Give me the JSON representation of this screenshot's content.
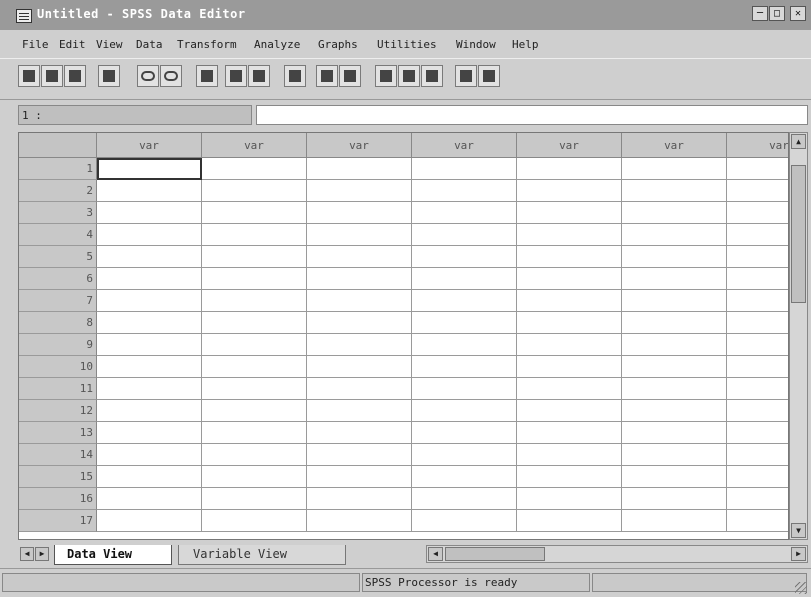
{
  "window": {
    "title": "Untitled - SPSS Data Editor"
  },
  "menu": [
    "File",
    "Edit",
    "View",
    "Data",
    "Transform",
    "Analyze",
    "Graphs",
    "Utilities",
    "Window",
    "Help"
  ],
  "toolbar": [
    {
      "name": "open-file-icon"
    },
    {
      "name": "save-icon"
    },
    {
      "name": "print-icon"
    },
    {
      "name": "dialog-recall-icon"
    },
    {
      "name": "undo-icon"
    },
    {
      "name": "redo-icon"
    },
    {
      "name": "goto-chart-icon"
    },
    {
      "name": "goto-case-icon"
    },
    {
      "name": "variables-icon"
    },
    {
      "name": "find-icon"
    },
    {
      "name": "insert-case-icon"
    },
    {
      "name": "insert-variable-icon"
    },
    {
      "name": "split-file-icon"
    },
    {
      "name": "weight-cases-icon"
    },
    {
      "name": "select-cases-icon"
    },
    {
      "name": "value-labels-icon"
    },
    {
      "name": "use-sets-icon"
    }
  ],
  "editor": {
    "cell_ref": "1 :",
    "cell_value": ""
  },
  "grid": {
    "columns": [
      "var",
      "var",
      "var",
      "var",
      "var",
      "var",
      "var"
    ],
    "rows": [
      "1",
      "2",
      "3",
      "4",
      "5",
      "6",
      "7",
      "8",
      "9",
      "10",
      "11",
      "12",
      "13",
      "14",
      "15",
      "16",
      "17"
    ],
    "active_row": 1,
    "active_col": 1
  },
  "tabs": {
    "data_view": "Data View",
    "variable_view": "Variable View"
  },
  "status": {
    "message": "SPSS Processor  is ready"
  }
}
